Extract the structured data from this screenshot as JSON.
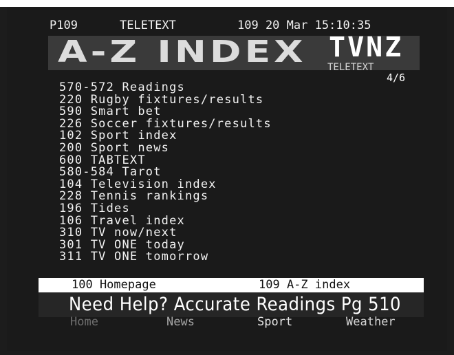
{
  "header": {
    "page": "P109",
    "service": "TELETEXT",
    "datetime": "109 20 Mar 15:10:35"
  },
  "banner": {
    "title": "A-Z INDEX",
    "logo": "TVNZ",
    "logo_sub": "TELETEXT",
    "page_counter": "4/6"
  },
  "index": [
    {
      "page": "570-572",
      "label": "Readings"
    },
    {
      "page": "220",
      "label": "Rugby fixtures/results"
    },
    {
      "page": "590",
      "label": "Smart bet"
    },
    {
      "page": "226",
      "label": "Soccer fixtures/results"
    },
    {
      "page": "102",
      "label": "Sport index"
    },
    {
      "page": "200",
      "label": "Sport news"
    },
    {
      "page": "600",
      "label": "TABTEXT"
    },
    {
      "page": "580-584",
      "label": "Tarot"
    },
    {
      "page": "104",
      "label": "Television index"
    },
    {
      "page": "228",
      "label": "Tennis rankings"
    },
    {
      "page": "196",
      "label": "Tides"
    },
    {
      "page": "106",
      "label": "Travel index"
    },
    {
      "page": "310",
      "label": "TV now/next"
    },
    {
      "page": "301",
      "label": "TV ONE today"
    },
    {
      "page": "311",
      "label": "TV ONE tomorrow"
    }
  ],
  "nav": {
    "home": "100 Homepage",
    "index": "109 A-Z index"
  },
  "help": "Need Help? Accurate Readings Pg 510",
  "fastext": {
    "red": "Home",
    "green": "News",
    "yellow": "Sport",
    "blue": "Weather"
  },
  "colors": {
    "screen_bg": "#1c1c1c",
    "text": "#f2f2f2",
    "nav_bar_bg": "#ffffff",
    "banner_bg": "#3a3a3a"
  }
}
